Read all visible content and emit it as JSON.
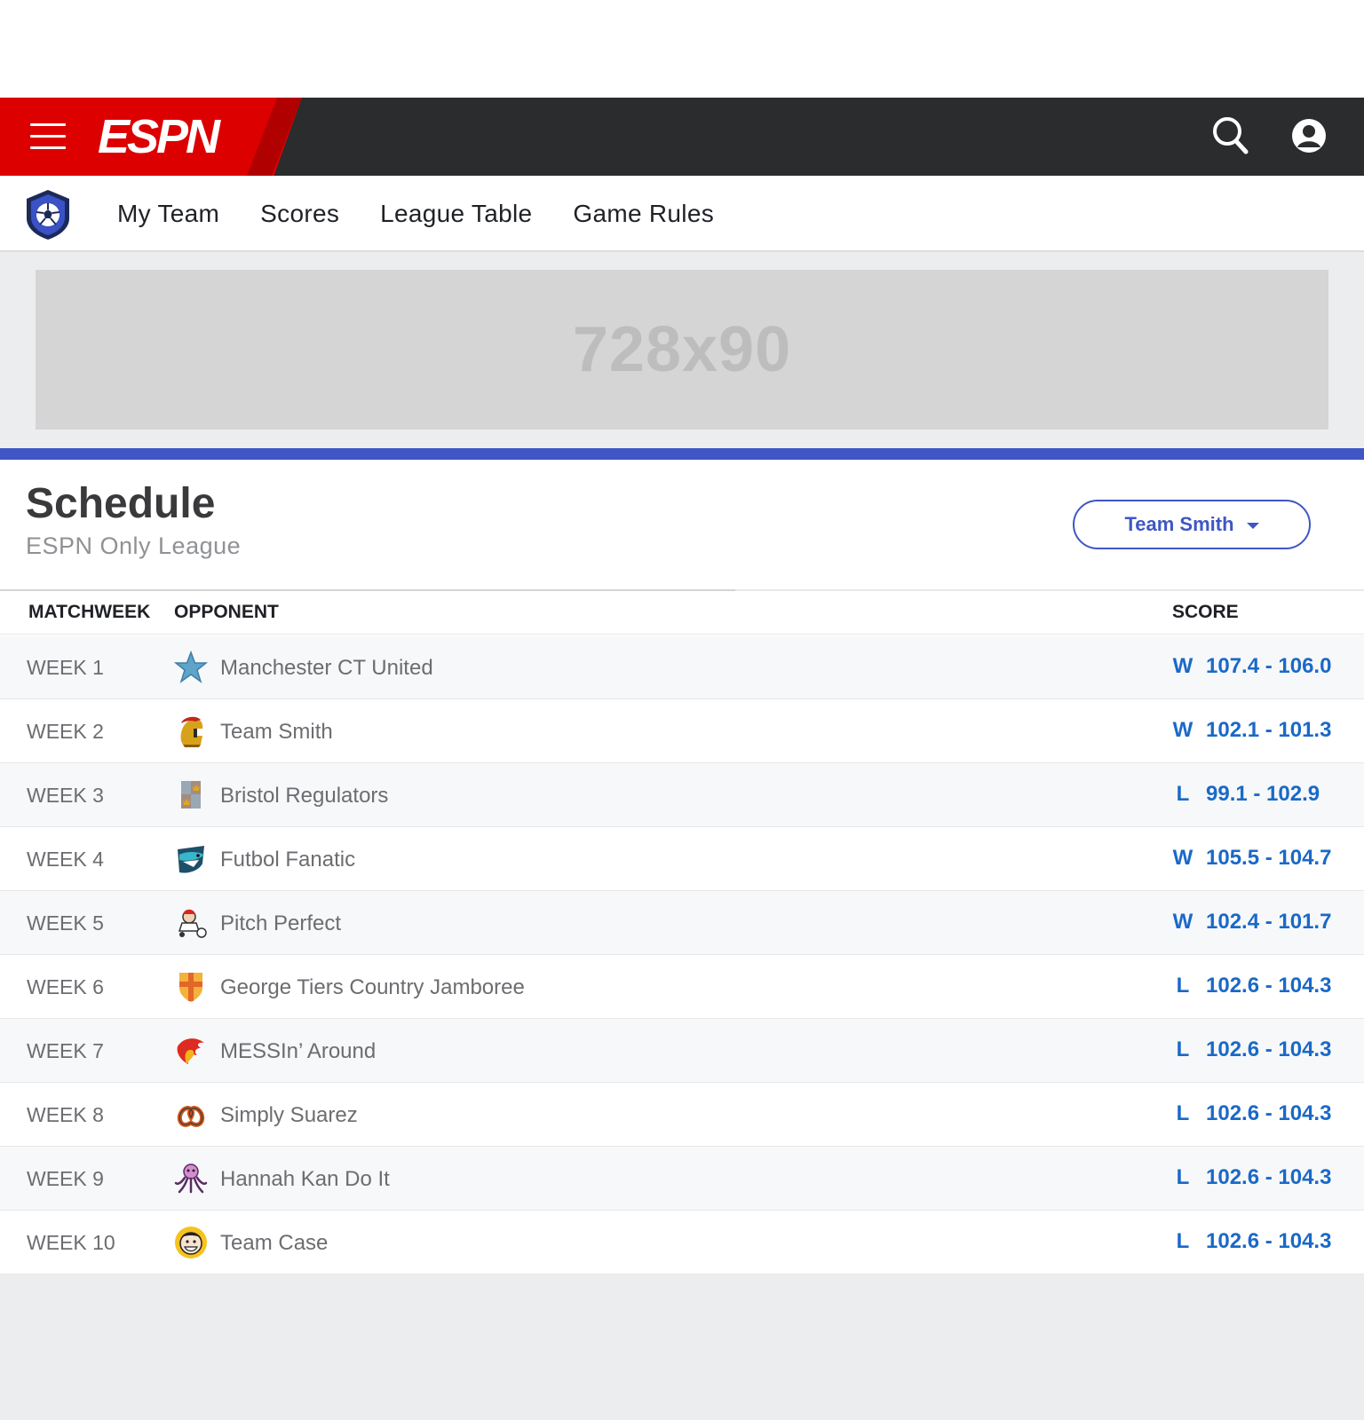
{
  "header": {
    "brand": "ESPN"
  },
  "nav": {
    "items": [
      {
        "label": "My Team"
      },
      {
        "label": "Scores"
      },
      {
        "label": "League Table"
      },
      {
        "label": "Game Rules"
      }
    ]
  },
  "ad": {
    "label": "728x90"
  },
  "schedule": {
    "title": "Schedule",
    "subtitle": "ESPN Only League",
    "team_select": "Team Smith",
    "columns": {
      "week": "MATCHWEEK",
      "opponent": "OPPONENT",
      "score": "SCORE"
    },
    "rows": [
      {
        "week": "WEEK 1",
        "opponent": "Manchester CT United",
        "result": "W",
        "score": "107.4 - 106.0",
        "icon": "star-icon"
      },
      {
        "week": "WEEK 2",
        "opponent": "Team Smith",
        "result": "W",
        "score": "102.1 - 101.3",
        "icon": "spartan-helmet-icon"
      },
      {
        "week": "WEEK 3",
        "opponent": "Bristol Regulators",
        "result": "L",
        "score": "99.1 - 102.9",
        "icon": "crown-flag-icon"
      },
      {
        "week": "WEEK 4",
        "opponent": "Futbol Fanatic",
        "result": "W",
        "score": "105.5 - 104.7",
        "icon": "shark-icon"
      },
      {
        "week": "WEEK 5",
        "opponent": "Pitch Perfect",
        "result": "W",
        "score": "102.4 - 101.7",
        "icon": "mascot-icon"
      },
      {
        "week": "WEEK 6",
        "opponent": "George Tiers Country Jamboree",
        "result": "L",
        "score": "102.6 - 104.3",
        "icon": "cross-shield-icon"
      },
      {
        "week": "WEEK 7",
        "opponent": "MESSIn’ Around",
        "result": "L",
        "score": "102.6 - 104.3",
        "icon": "flame-bird-icon"
      },
      {
        "week": "WEEK 8",
        "opponent": "Simply Suarez",
        "result": "L",
        "score": "102.6 - 104.3",
        "icon": "pretzel-icon"
      },
      {
        "week": "WEEK 9",
        "opponent": "Hannah Kan Do It",
        "result": "L",
        "score": "102.6 - 104.3",
        "icon": "octopus-icon"
      },
      {
        "week": "WEEK 10",
        "opponent": "Team Case",
        "result": "L",
        "score": "102.6 - 104.3",
        "icon": "clown-face-icon"
      }
    ]
  },
  "colors": {
    "espn_red": "#dd0000",
    "header_dark": "#2b2c2d",
    "accent_blue": "#3f56c4",
    "score_blue": "#1a69c7"
  }
}
